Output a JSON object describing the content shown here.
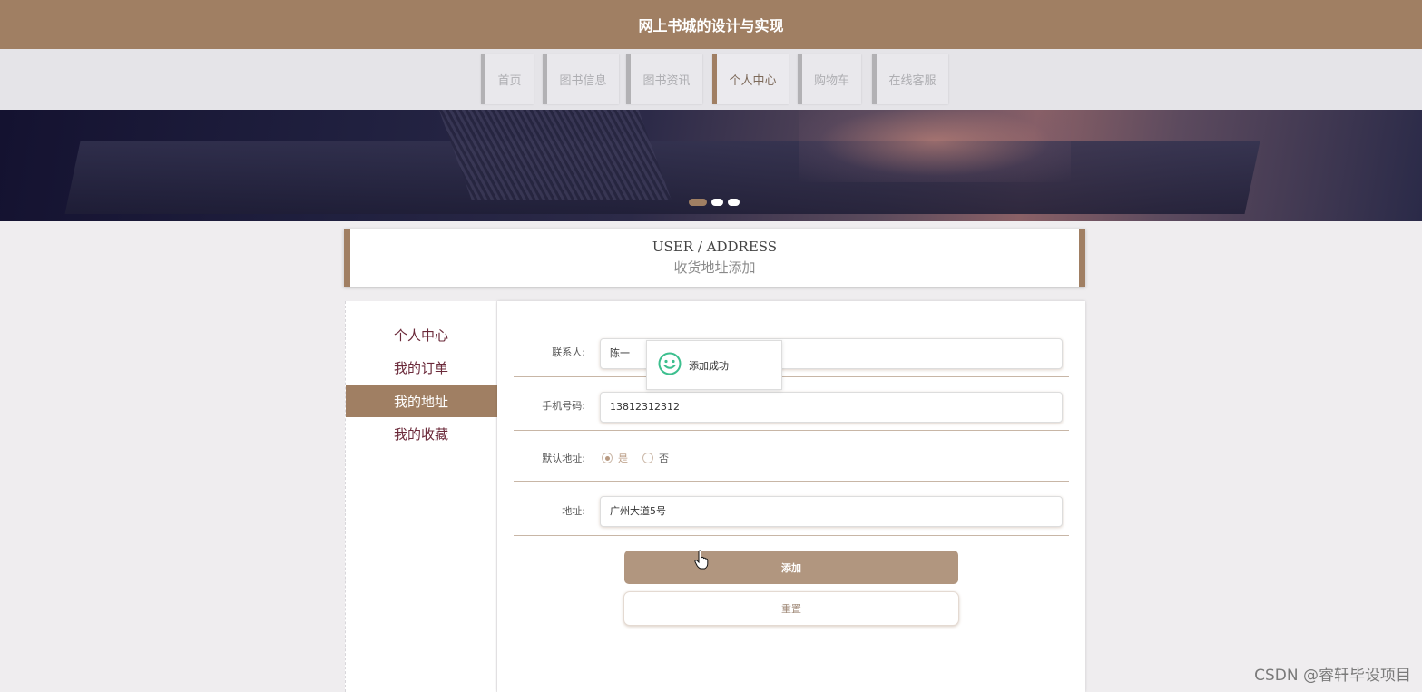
{
  "header": {
    "title": "网上书城的设计与实现"
  },
  "nav": {
    "items": [
      "首页",
      "图书信息",
      "图书资讯",
      "个人中心",
      "购物车",
      "在线客服"
    ],
    "active_index": 3
  },
  "banner": {
    "slide_count": 3,
    "active_slide": 0
  },
  "section": {
    "title_en": "USER / ADDRESS",
    "title_cn": "收货地址添加"
  },
  "sidebar": {
    "items": [
      "个人中心",
      "我的订单",
      "我的地址",
      "我的收藏"
    ],
    "active_index": 2
  },
  "form": {
    "contact_label": "联系人:",
    "contact_value": "陈一",
    "phone_label": "手机号码:",
    "phone_value": "13812312312",
    "default_label": "默认地址:",
    "default_yes": "是",
    "default_no": "否",
    "default_selected": "是",
    "address_label": "地址:",
    "address_value": "广州大道5号",
    "submit_label": "添加",
    "reset_label": "重置"
  },
  "toast": {
    "message": "添加成功",
    "icon": "smile-icon"
  },
  "watermark": "CSDN @睿轩毕设项目",
  "colors": {
    "brand": "#a07f63",
    "accent_text": "#6b2a3a",
    "toast_icon": "#3cbf8e"
  }
}
